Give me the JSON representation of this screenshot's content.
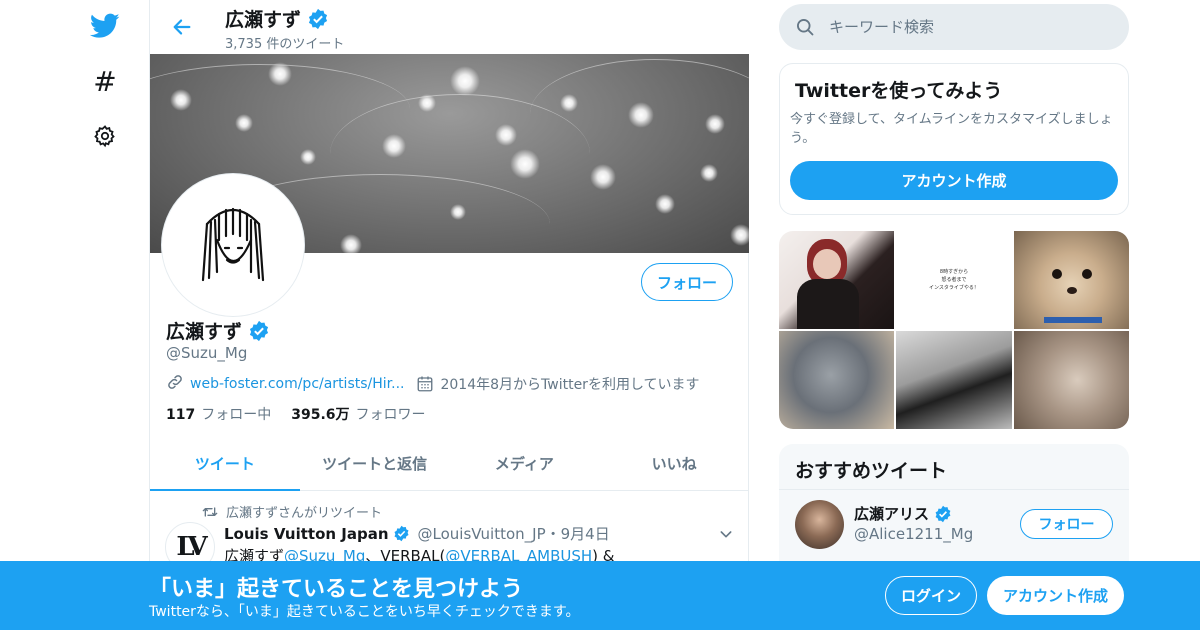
{
  "nav": {
    "icons": [
      "twitter-bird-icon",
      "hashtag-icon",
      "gear-icon"
    ],
    "explore_glyph": "#"
  },
  "header": {
    "name": "広瀬すず",
    "tweet_count": "3,735 件のツイート"
  },
  "profile": {
    "name": "広瀬すず",
    "handle": "@Suzu_Mg",
    "website": "web-foster.com/pc/artists/Hir...",
    "joined": "2014年8月からTwitterを利用しています",
    "following_count": "117",
    "following_label": "フォロー中",
    "followers_count": "395.6万",
    "followers_label": "フォロワー",
    "follow_button": "フォロー"
  },
  "tabs": [
    {
      "label": "ツイート",
      "active": true
    },
    {
      "label": "ツイートと返信",
      "active": false
    },
    {
      "label": "メディア",
      "active": false
    },
    {
      "label": "いいね",
      "active": false
    }
  ],
  "tweet": {
    "retweet_line": "広瀬すずさんがリツイート",
    "avatar_text": "LV",
    "author": "Louis Vuitton Japan",
    "handle_date": "@LouisVuitton_JP・9月4日",
    "text_start": "広瀬すず",
    "mention1": "@Suzu_Mg",
    "text_mid": "、VERBAL(",
    "mention2": "@VERBAL_AMBUSH",
    "text_end": ") &"
  },
  "search": {
    "placeholder": "キーワード検索"
  },
  "signup_card": {
    "title": "Twitterを使ってみよう",
    "description": "今すぐ登録して、タイムラインをカスタマイズしましょう。",
    "button": "アカウント作成"
  },
  "media_grid": {
    "poster_text": "8時すぎから\n怒る者まで\nインスタライブやる！"
  },
  "suggested": {
    "title": "おすすめツイート",
    "name": "広瀬アリス",
    "handle": "@Alice1211_Mg",
    "follow_button": "フォロー"
  },
  "bottom_bar": {
    "title": "「いま」起きていることを見つけよう",
    "subtitle": "Twitterなら、「いま」起きていることをいち早くチェックできます。",
    "login": "ログイン",
    "signup": "アカウント作成"
  },
  "colors": {
    "brand": "#1da1f2",
    "link": "#1b95e0",
    "secondary_text": "#657786",
    "border": "#e6ecf0"
  }
}
